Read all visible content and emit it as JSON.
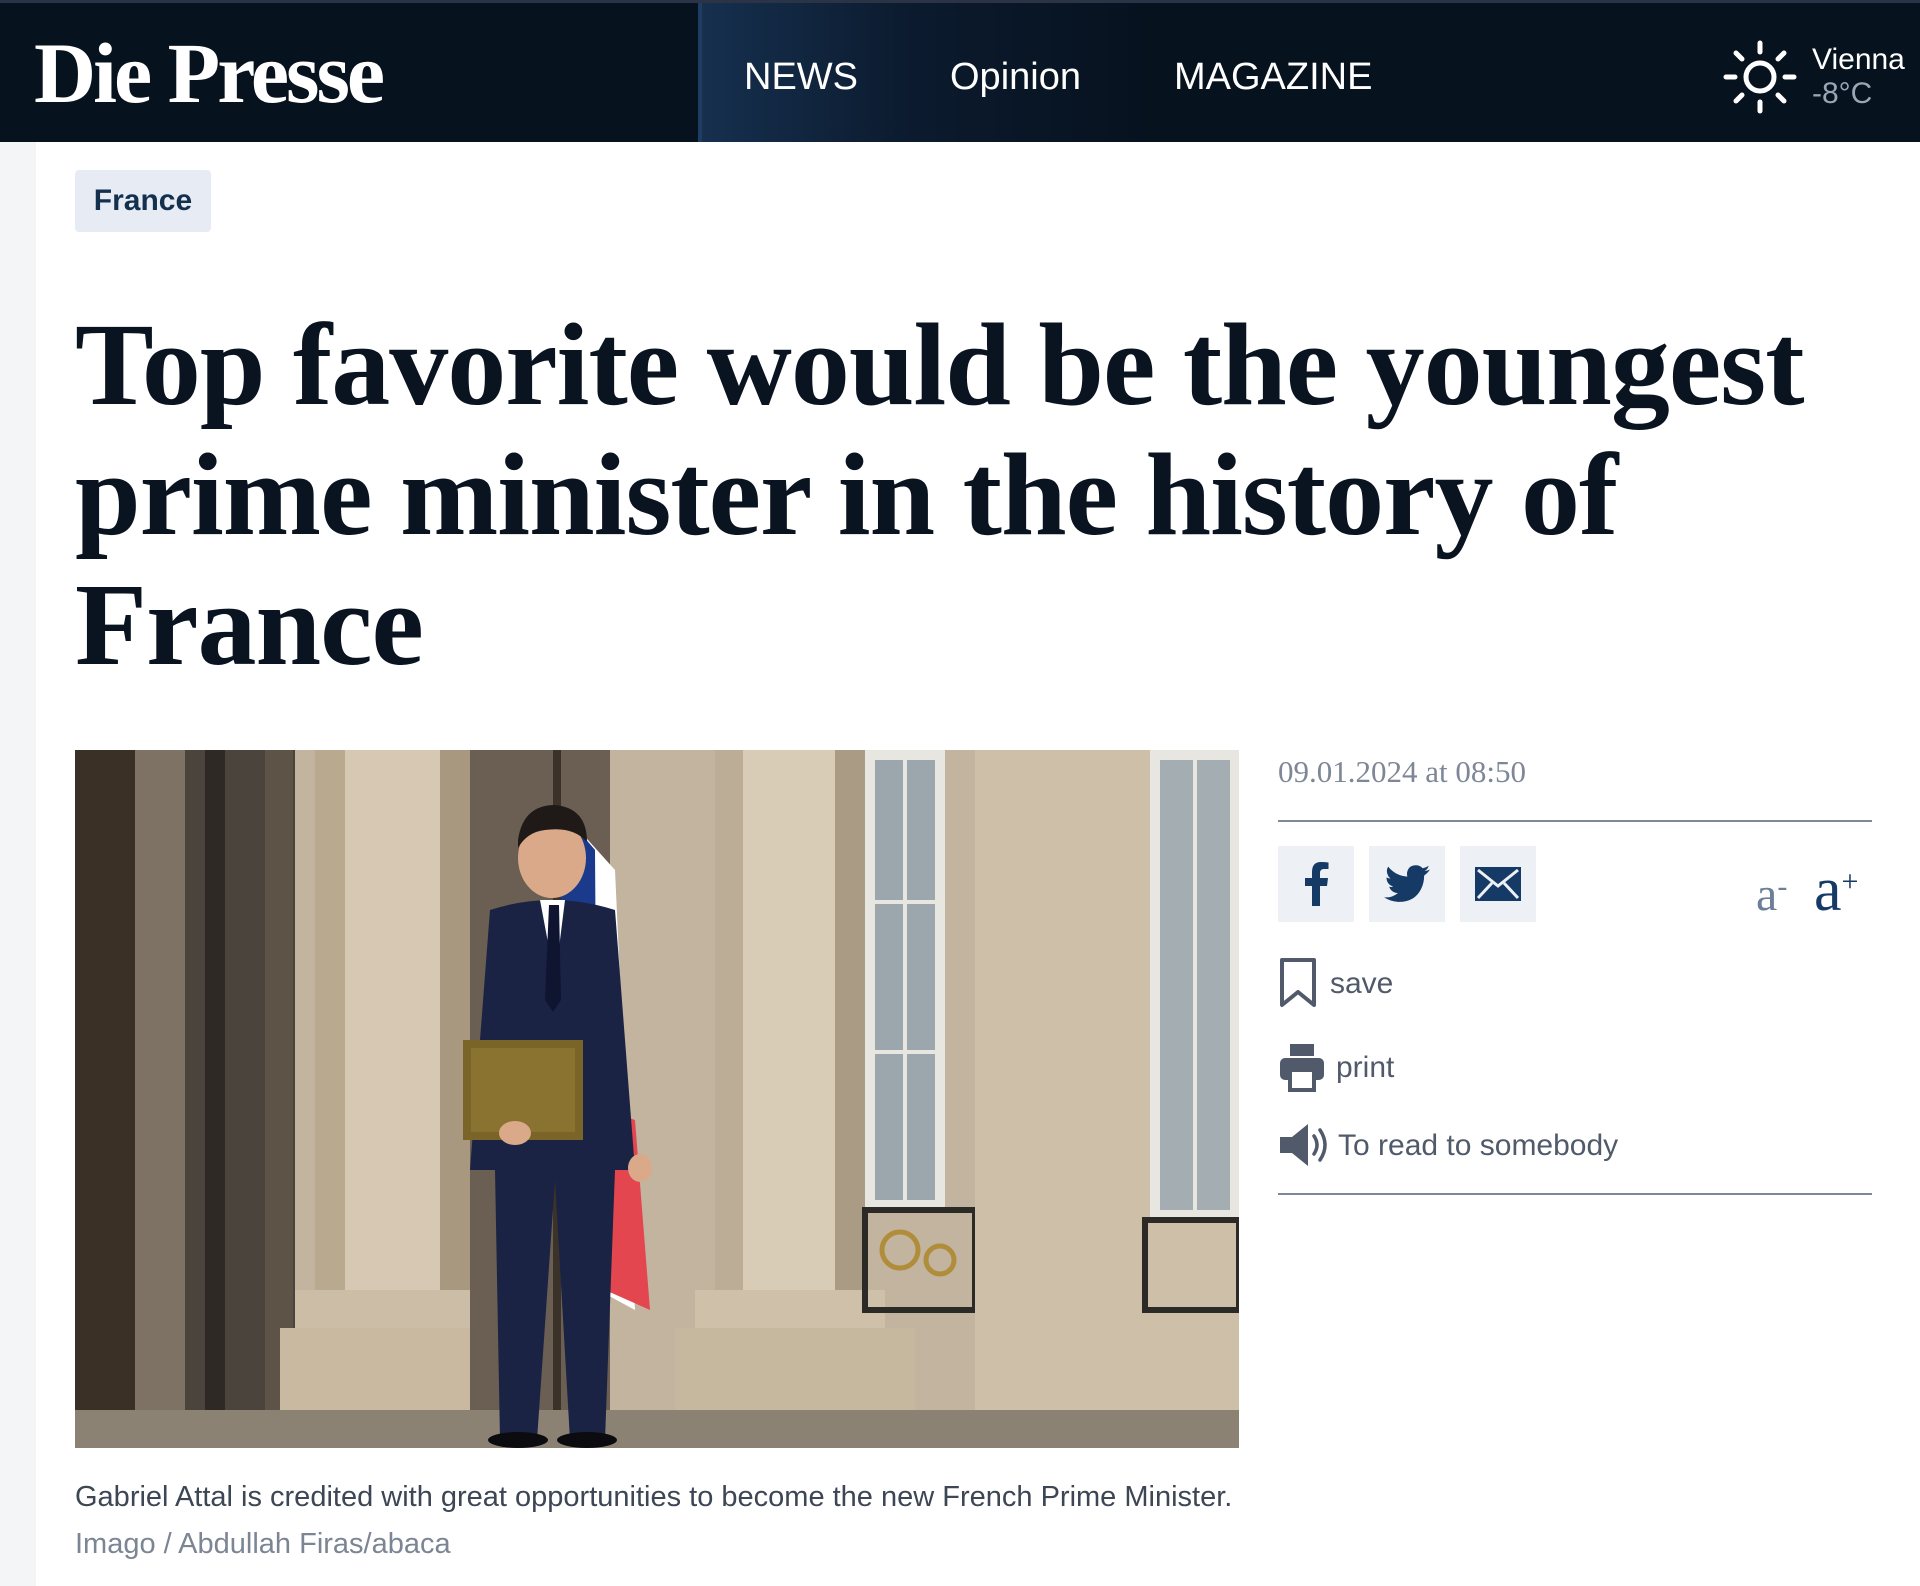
{
  "header": {
    "logo": "Die Presse",
    "nav": [
      "NEWS",
      "Opinion",
      "MAGAZINE"
    ],
    "weather": {
      "city": "Vienna",
      "temperature": "-8°C",
      "icon": "sun-icon"
    }
  },
  "article": {
    "category": "France",
    "headline": "Top favorite would be the youngest prime minister in the history of France",
    "date": "09.01.2024 at 08:50",
    "caption": "Gabriel Attal is credited with great opportunities to become the new French Prime Minister.",
    "credit": "Imago / Abdullah Firas/abaca"
  },
  "sidebar": {
    "share": [
      {
        "name": "facebook",
        "icon": "facebook-icon"
      },
      {
        "name": "twitter",
        "icon": "twitter-icon"
      },
      {
        "name": "email",
        "icon": "mail-icon"
      }
    ],
    "font_size": {
      "smaller": "a",
      "smaller_mark": "-",
      "larger": "a",
      "larger_mark": "+"
    },
    "actions": {
      "save": "save",
      "print": "print",
      "read": "To read to somebody"
    }
  },
  "colors": {
    "header_bg": "#07121f",
    "accent": "#163a66",
    "tag_bg": "#e7ecf4",
    "flag_blue": "#1b3a8c",
    "flag_red": "#e4464f"
  }
}
